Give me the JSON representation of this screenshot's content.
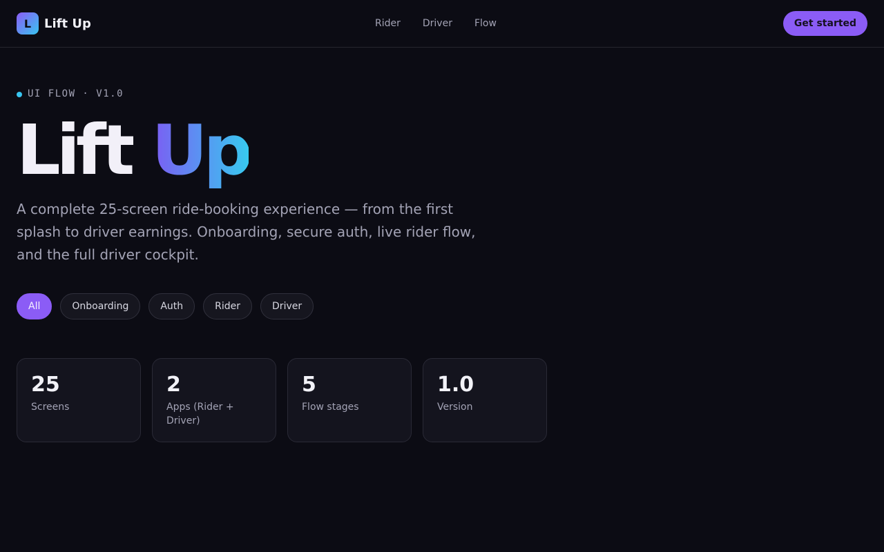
{
  "header": {
    "logo_letter": "L",
    "brand": "Lift Up",
    "nav": [
      "Rider",
      "Driver",
      "Flow"
    ],
    "cta": "Get started"
  },
  "hero": {
    "eyebrow": "UI FLOW · V1.0",
    "title_part1": "Lift",
    "title_part2": "Up",
    "description": "A complete 25-screen ride-booking experience — from the first splash to driver earnings. Onboarding, secure auth, live rider flow, and the full driver cockpit."
  },
  "filters": {
    "items": [
      "All",
      "Onboarding",
      "Auth",
      "Rider",
      "Driver"
    ],
    "active": "All"
  },
  "stats": [
    {
      "value": "25",
      "label": "Screens"
    },
    {
      "value": "2",
      "label": "Apps (Rider + Driver)"
    },
    {
      "value": "5",
      "label": "Flow stages"
    },
    {
      "value": "1.0",
      "label": "Version"
    }
  ],
  "colors": {
    "background": "#0c0c14",
    "accent": "#8b5cf6",
    "accent_secondary": "#38c5f0",
    "muted_text": "#a3a3b5"
  }
}
